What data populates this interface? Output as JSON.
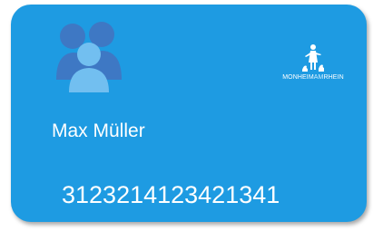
{
  "card": {
    "holder_name": "Max Müller",
    "number": "3123214123421341",
    "colors": {
      "background": "#1e9be2",
      "avatar_back": "#3e78c4",
      "avatar_front": "#72bff0",
      "text": "#ffffff"
    }
  },
  "logo": {
    "text_part1": "MONHEIM",
    "text_part2": "AM",
    "text_part3": "RHEIN",
    "figure_icon": "goose-girl-icon"
  },
  "avatar": {
    "icon": "users-group-icon"
  }
}
